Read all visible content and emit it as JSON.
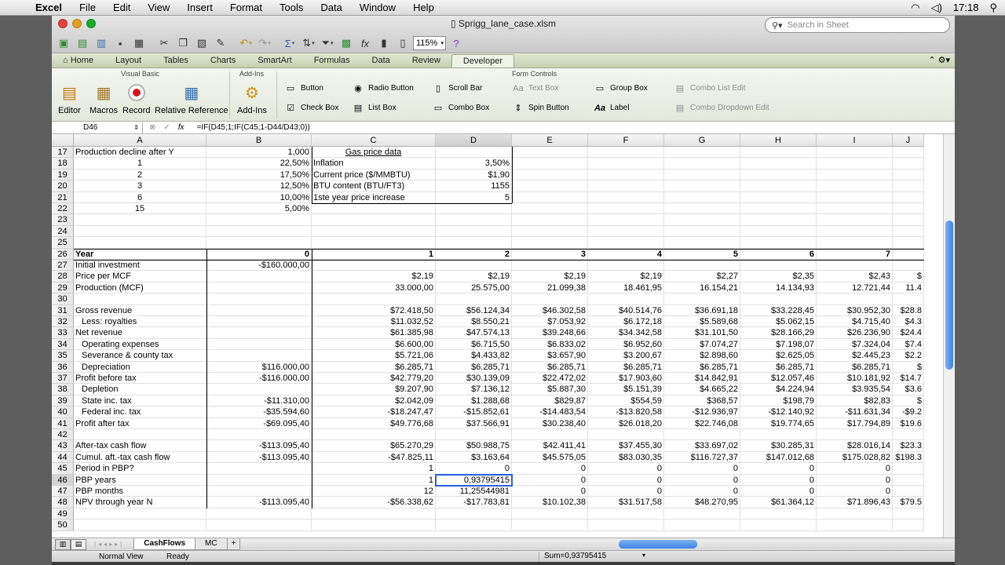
{
  "menubar": {
    "app": "Excel",
    "items": [
      "File",
      "Edit",
      "View",
      "Insert",
      "Format",
      "Tools",
      "Data",
      "Window",
      "Help"
    ],
    "clock": "17:18"
  },
  "window": {
    "title": "Sprigg_lane_case.xlsm",
    "zoom": "115%",
    "search_placeholder": "Search in Sheet"
  },
  "ribbon": {
    "tabs": [
      "Home",
      "Layout",
      "Tables",
      "Charts",
      "SmartArt",
      "Formulas",
      "Data",
      "Review",
      "Developer"
    ],
    "active_tab": "Developer",
    "groups": {
      "visual_basic": "Visual Basic",
      "add_ins": "Add-Ins",
      "form_controls": "Form Controls"
    },
    "buttons": {
      "editor": "Editor",
      "macros": "Macros",
      "record": "Record",
      "relative_reference": "Relative Reference",
      "add_ins": "Add-Ins"
    },
    "form_controls": {
      "button": "Button",
      "radio_button": "Radio Button",
      "scroll_bar": "Scroll Bar",
      "text_box": "Text Box",
      "group_box": "Group Box",
      "combo_list_edit": "Combo List Edit",
      "check_box": "Check Box",
      "list_box": "List Box",
      "combo_box": "Combo Box",
      "spin_button": "Spin Button",
      "label": "Label",
      "combo_dropdown_edit": "Combo Dropdown Edit"
    }
  },
  "formula_bar": {
    "cell_ref": "D46",
    "formula": "=IF(D45;1;IF(C45;1-D44/D43;0))"
  },
  "columns": [
    "A",
    "B",
    "C",
    "D",
    "E",
    "F",
    "G",
    "H",
    "I",
    "J"
  ],
  "selected_column": "D",
  "selected_row": "46",
  "rows": [
    {
      "n": "17",
      "A": "Production decline after Y",
      "B": "1,000",
      "C": "Gas price data"
    },
    {
      "n": "18",
      "A": "1",
      "B": "22,50%",
      "C": "Inflation",
      "D": "3,50%"
    },
    {
      "n": "19",
      "A": "2",
      "B": "17,50%",
      "C": "Current price ($/MMBTU)",
      "D": "$1,90"
    },
    {
      "n": "20",
      "A": "3",
      "B": "12,50%",
      "C": "BTU content (BTU/FT3)",
      "D": "1155"
    },
    {
      "n": "21",
      "A": "6",
      "B": "10,00%",
      "C": "1ste year price increase",
      "D": "5"
    },
    {
      "n": "22",
      "A": "15",
      "B": "5,00%"
    },
    {
      "n": "23"
    },
    {
      "n": "24"
    },
    {
      "n": "25"
    },
    {
      "n": "26",
      "A": "Year",
      "B": "0",
      "C": "1",
      "D": "2",
      "E": "3",
      "F": "4",
      "G": "5",
      "H": "6",
      "I": "7"
    },
    {
      "n": "27",
      "A": "Initial investment",
      "B": "-$160.000,00"
    },
    {
      "n": "28",
      "A": "Price per MCF",
      "C": "$2,19",
      "D": "$2,19",
      "E": "$2,19",
      "F": "$2,19",
      "G": "$2,27",
      "H": "$2,35",
      "I": "$2,43",
      "J": "$"
    },
    {
      "n": "29",
      "A": "Production (MCF)",
      "C": "33.000,00",
      "D": "25.575,00",
      "E": "21.099,38",
      "F": "18.461,95",
      "G": "16.154,21",
      "H": "14.134,93",
      "I": "12.721,44",
      "J": "11.4"
    },
    {
      "n": "30"
    },
    {
      "n": "31",
      "A": "Gross revenue",
      "C": "$72.418,50",
      "D": "$56.124,34",
      "E": "$46.302,58",
      "F": "$40.514,76",
      "G": "$36.691,18",
      "H": "$33.228,45",
      "I": "$30.952,30",
      "J": "$28.8"
    },
    {
      "n": "32",
      "A": "Less: royalties",
      "C": "$11.032,52",
      "D": "$8.550,21",
      "E": "$7.053,92",
      "F": "$6.172,18",
      "G": "$5.589,68",
      "H": "$5.062,15",
      "I": "$4.715,40",
      "J": "$4.3"
    },
    {
      "n": "33",
      "A": "Net revenue",
      "C": "$61.385,98",
      "D": "$47.574,13",
      "E": "$39.248,66",
      "F": "$34.342,58",
      "G": "$31.101,50",
      "H": "$28.166,29",
      "I": "$26.236,90",
      "J": "$24.4"
    },
    {
      "n": "34",
      "A": "Operating expenses",
      "C": "$6.600,00",
      "D": "$6.715,50",
      "E": "$6.833,02",
      "F": "$6.952,60",
      "G": "$7.074,27",
      "H": "$7.198,07",
      "I": "$7.324,04",
      "J": "$7.4"
    },
    {
      "n": "35",
      "A": "Severance & county tax",
      "C": "$5.721,06",
      "D": "$4.433,82",
      "E": "$3.657,90",
      "F": "$3.200,67",
      "G": "$2.898,60",
      "H": "$2.625,05",
      "I": "$2.445,23",
      "J": "$2.2"
    },
    {
      "n": "36",
      "A": "Depreciation",
      "B": "$116.000,00",
      "C": "$6.285,71",
      "D": "$6.285,71",
      "E": "$6.285,71",
      "F": "$6.285,71",
      "G": "$6.285,71",
      "H": "$6.285,71",
      "I": "$6.285,71",
      "J": "$"
    },
    {
      "n": "37",
      "A": "Profit before tax",
      "B": "-$116.000,00",
      "C": "$42.779,20",
      "D": "$30.139,09",
      "E": "$22.472,02",
      "F": "$17.903,60",
      "G": "$14.842,91",
      "H": "$12.057,46",
      "I": "$10.181,92",
      "J": "$14.7"
    },
    {
      "n": "38",
      "A": "Depletion",
      "C": "$9.207,90",
      "D": "$7.136,12",
      "E": "$5.887,30",
      "F": "$5.151,39",
      "G": "$4.665,22",
      "H": "$4.224,94",
      "I": "$3.935,54",
      "J": "$3.6"
    },
    {
      "n": "39",
      "A": "State inc. tax",
      "B": "-$11.310,00",
      "C": "$2.042,09",
      "D": "$1.288,68",
      "E": "$829,87",
      "F": "$554,59",
      "G": "$368,57",
      "H": "$198,79",
      "I": "$82,83",
      "J": "$"
    },
    {
      "n": "40",
      "A": "Federal inc. tax",
      "B": "-$35.594,60",
      "C": "-$18.247,47",
      "D": "-$15.852,61",
      "E": "-$14.483,54",
      "F": "-$13.820,58",
      "G": "-$12.936,97",
      "H": "-$12.140,92",
      "I": "-$11.631,34",
      "J": "-$9.2"
    },
    {
      "n": "41",
      "A": "Profit after tax",
      "B": "-$69.095,40",
      "C": "$49.776,68",
      "D": "$37.566,91",
      "E": "$30.238,40",
      "F": "$26.018,20",
      "G": "$22.746,08",
      "H": "$19.774,65",
      "I": "$17.794,89",
      "J": "$19.6"
    },
    {
      "n": "42"
    },
    {
      "n": "43",
      "A": "After-tax cash flow",
      "B": "-$113.095,40",
      "C": "$65.270,29",
      "D": "$50.988,75",
      "E": "$42.411,41",
      "F": "$37.455,30",
      "G": "$33.697,02",
      "H": "$30.285,31",
      "I": "$28.016,14",
      "J": "$23.3"
    },
    {
      "n": "44",
      "A": "Cumul. aft.-tax cash flow",
      "B": "-$113.095,40",
      "C": "-$47.825,11",
      "D": "$3.163,64",
      "E": "$45.575,05",
      "F": "$83.030,35",
      "G": "$116.727,37",
      "H": "$147.012,68",
      "I": "$175.028,82",
      "J": "$198.3"
    },
    {
      "n": "45",
      "A": "Period in PBP?",
      "C": "1",
      "D": "0",
      "E": "0",
      "F": "0",
      "G": "0",
      "H": "0",
      "I": "0"
    },
    {
      "n": "46",
      "A": "PBP years",
      "C": "1",
      "D": "0,93795415",
      "E": "0",
      "F": "0",
      "G": "0",
      "H": "0",
      "I": "0"
    },
    {
      "n": "47",
      "A": "PBP months",
      "C": "12",
      "D": "11,25544981",
      "E": "0",
      "F": "0",
      "G": "0",
      "H": "0",
      "I": "0"
    },
    {
      "n": "48",
      "A": "NPV through year N",
      "B": "-$113.095,40",
      "C": "-$56.338,62",
      "D": "-$17.783,81",
      "E": "$10.102,38",
      "F": "$31.517,58",
      "G": "$48.270,95",
      "H": "$61.364,12",
      "I": "$71.896,43",
      "J": "$79.5"
    },
    {
      "n": "49"
    },
    {
      "n": "50"
    }
  ],
  "sheets": [
    "CashFlows",
    "MC"
  ],
  "active_sheet": "CashFlows",
  "status": {
    "view": "Normal View",
    "state": "Ready",
    "sum": "Sum=0,93795415"
  }
}
